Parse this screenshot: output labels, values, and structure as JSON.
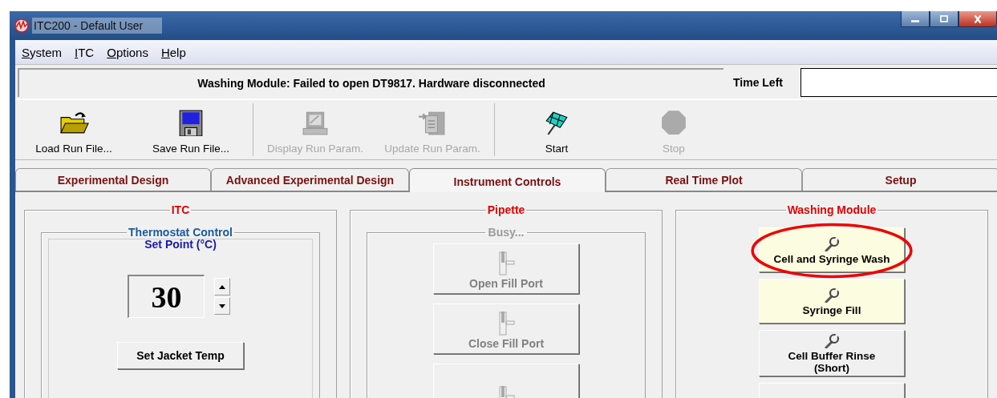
{
  "window": {
    "title": "ITC200 - Default User"
  },
  "menu": [
    {
      "label": "System"
    },
    {
      "label": "ITC"
    },
    {
      "label": "Options"
    },
    {
      "label": "Help"
    }
  ],
  "status": {
    "message": "Washing Module: Failed to open DT9817. Hardware disconnected",
    "time_left_label": "Time Left"
  },
  "toolbar": [
    [
      {
        "kind": "open",
        "label": "Load Run File...",
        "disabled": false
      },
      {
        "kind": "save",
        "label": "Save Run File...",
        "disabled": false
      }
    ],
    [
      {
        "kind": "display",
        "label": "Display Run Param.",
        "disabled": true
      },
      {
        "kind": "update",
        "label": "Update Run Param.",
        "disabled": true
      }
    ],
    [
      {
        "kind": "start",
        "label": "Start",
        "disabled": false
      },
      {
        "kind": "stop",
        "label": "Stop",
        "disabled": true
      }
    ]
  ],
  "tabs": [
    {
      "label": "Experimental Design",
      "selected": false
    },
    {
      "label": "Advanced Experimental Design",
      "selected": false
    },
    {
      "label": "Instrument Controls",
      "selected": true
    },
    {
      "label": "Real Time Plot",
      "selected": false
    },
    {
      "label": "Setup",
      "selected": false
    }
  ],
  "itc": {
    "title": "ITC",
    "thermostat": {
      "title": "Thermostat Control",
      "set_point_label": "Set Point (°C)",
      "value": "30",
      "button": "Set Jacket Temp"
    }
  },
  "pipette": {
    "title": "Pipette",
    "group_title": "Busy...",
    "buttons": [
      {
        "label": "Open Fill Port",
        "disabled": true
      },
      {
        "label": "Close Fill Port",
        "disabled": true
      },
      {
        "disabled": true
      }
    ]
  },
  "washing": {
    "title": "Washing Module",
    "buttons": [
      {
        "label": "Cell and Syringe Wash",
        "lit": true,
        "highlighted": true
      },
      {
        "label": "Syringe Fill",
        "lit": true,
        "highlighted": false
      },
      {
        "label": "Cell Buffer Rinse (Short)",
        "lit": false,
        "highlighted": false
      },
      {
        "lit": false,
        "highlighted": false
      }
    ]
  }
}
